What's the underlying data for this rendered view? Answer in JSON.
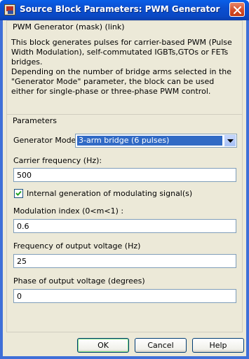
{
  "window": {
    "title": "Source Block Parameters: PWM Generator"
  },
  "description": {
    "header": "PWM Generator (mask) (link)",
    "paragraph1": "This block generates pulses for carrier-based PWM (Pulse Width Modulation), self-commutated IGBTs,GTOs or FETs bridges.",
    "paragraph2": "Depending on the number of bridge arms selected in the \"Generator Mode\" parameter, the block can be used either for single-phase or three-phase PWM control."
  },
  "parameters": {
    "header": "Parameters",
    "generator_mode": {
      "label": "Generator Mode",
      "value": "3-arm  bridge (6 pulses)"
    },
    "carrier_frequency": {
      "label": "Carrier frequency (Hz):",
      "value": "500"
    },
    "internal_generation": {
      "label": "Internal generation of modulating signal(s)",
      "checked": true
    },
    "modulation_index": {
      "label": "Modulation index  (0<m<1) :",
      "value": "0.6"
    },
    "output_frequency": {
      "label": "Frequency of output voltage (Hz)",
      "value": "25"
    },
    "output_phase": {
      "label": "Phase of output voltage (degrees)",
      "value": "0"
    }
  },
  "buttons": {
    "ok": "OK",
    "cancel": "Cancel",
    "help": "Help"
  },
  "icons": {
    "app": "simulink-block-icon",
    "close": "close-icon",
    "dropdown": "chevron-down-icon",
    "check": "checkmark-icon"
  },
  "colors": {
    "titlebar": "#0a52d4",
    "dialog_bg": "#ece9d8",
    "selection": "#316ac5",
    "close_button": "#d24a26"
  }
}
